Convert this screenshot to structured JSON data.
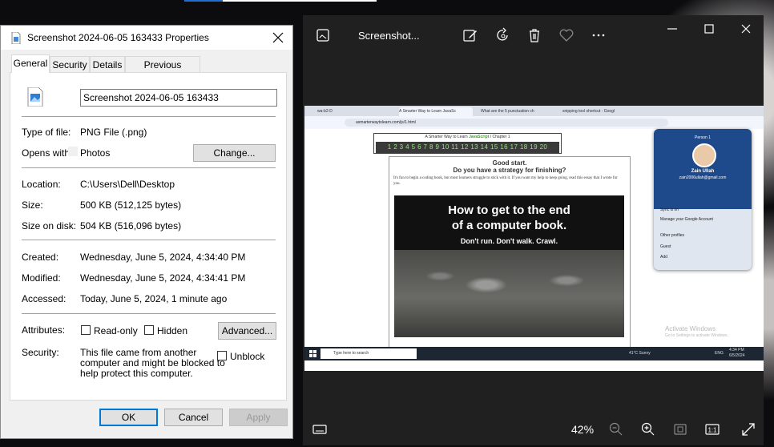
{
  "dialog": {
    "title": "Screenshot 2024-06-05 163433 Properties",
    "tabs": [
      "General",
      "Security",
      "Details",
      "Previous Versions"
    ],
    "filename": "Screenshot 2024-06-05 163433",
    "type_label": "Type of file:",
    "type_value": "PNG File (.png)",
    "opens_label": "Opens with:",
    "opens_value": "Photos",
    "change_button": "Change...",
    "location_label": "Location:",
    "location_value": "C:\\Users\\Dell\\Desktop",
    "size_label": "Size:",
    "size_value": "500 KB (512,125 bytes)",
    "sizedisk_label": "Size on disk:",
    "sizedisk_value": "504 KB (516,096 bytes)",
    "created_label": "Created:",
    "created_value": "Wednesday, June 5, 2024, 4:34:40 PM",
    "modified_label": "Modified:",
    "modified_value": "Wednesday, June 5, 2024, 4:34:41 PM",
    "accessed_label": "Accessed:",
    "accessed_value": "Today, June 5, 2024, 1 minute ago",
    "attributes_label": "Attributes:",
    "readonly_label": "Read-only",
    "hidden_label": "Hidden",
    "advanced_button": "Advanced...",
    "security_label": "Security:",
    "security_text_1": "This file came from another",
    "security_text_2": "computer and might be blocked to",
    "security_text_3": "help protect this computer.",
    "unblock_label": "Unblock",
    "ok_button": "OK",
    "cancel_button": "Cancel",
    "apply_button": "Apply"
  },
  "viewer": {
    "title": "Screenshot...",
    "zoom": "42%",
    "colors": {
      "background": "#202020",
      "text": "#ffffff"
    }
  },
  "embedded": {
    "tabs": [
      "wa-b2-D",
      "A Smarter Way to Learn JavaSc",
      "What are the 5 punctuation ch",
      "snipping tool shortcut - Googl"
    ],
    "url": "asmarterwaytolearn.com/js/1.html",
    "chapter_title_prefix": "A Smarter Way to Learn ",
    "chapter_title_js": "JavaScript",
    "chapter_title_suffix": " / Chapter 1",
    "chapter_numbers": "1 2 3 4 5 6 7 8 9 10 11 12 13 14 15 16 17 18 19 20",
    "heading_1": "Good start.",
    "heading_2": "Do you have a strategy for finishing?",
    "paragraph": "It's fun to begin a coding book, but most learners struggle to stick with it. If you want my help to keep going, read this essay that I wrote for you.",
    "banner_line_1": "How to get to the end",
    "banner_line_2": "of a computer book.",
    "banner_line_3": "Don't run. Don't walk. Crawl.",
    "profile": {
      "label": "Person 1",
      "name": "Zain Ullah",
      "email": "zain2006ullah@gmail.com",
      "sync": "Sync is on",
      "manage": "Manage your Google Account",
      "other": "Other profiles",
      "guest": "Guest",
      "add": "Add"
    },
    "watermark_1": "Activate Windows",
    "watermark_2": "Go to Settings to activate Windows.",
    "taskbar_search": "Type here to search",
    "weather": "41°C  Sunny",
    "lang": "ENG",
    "time": "4:34 PM",
    "date": "6/5/2024"
  }
}
